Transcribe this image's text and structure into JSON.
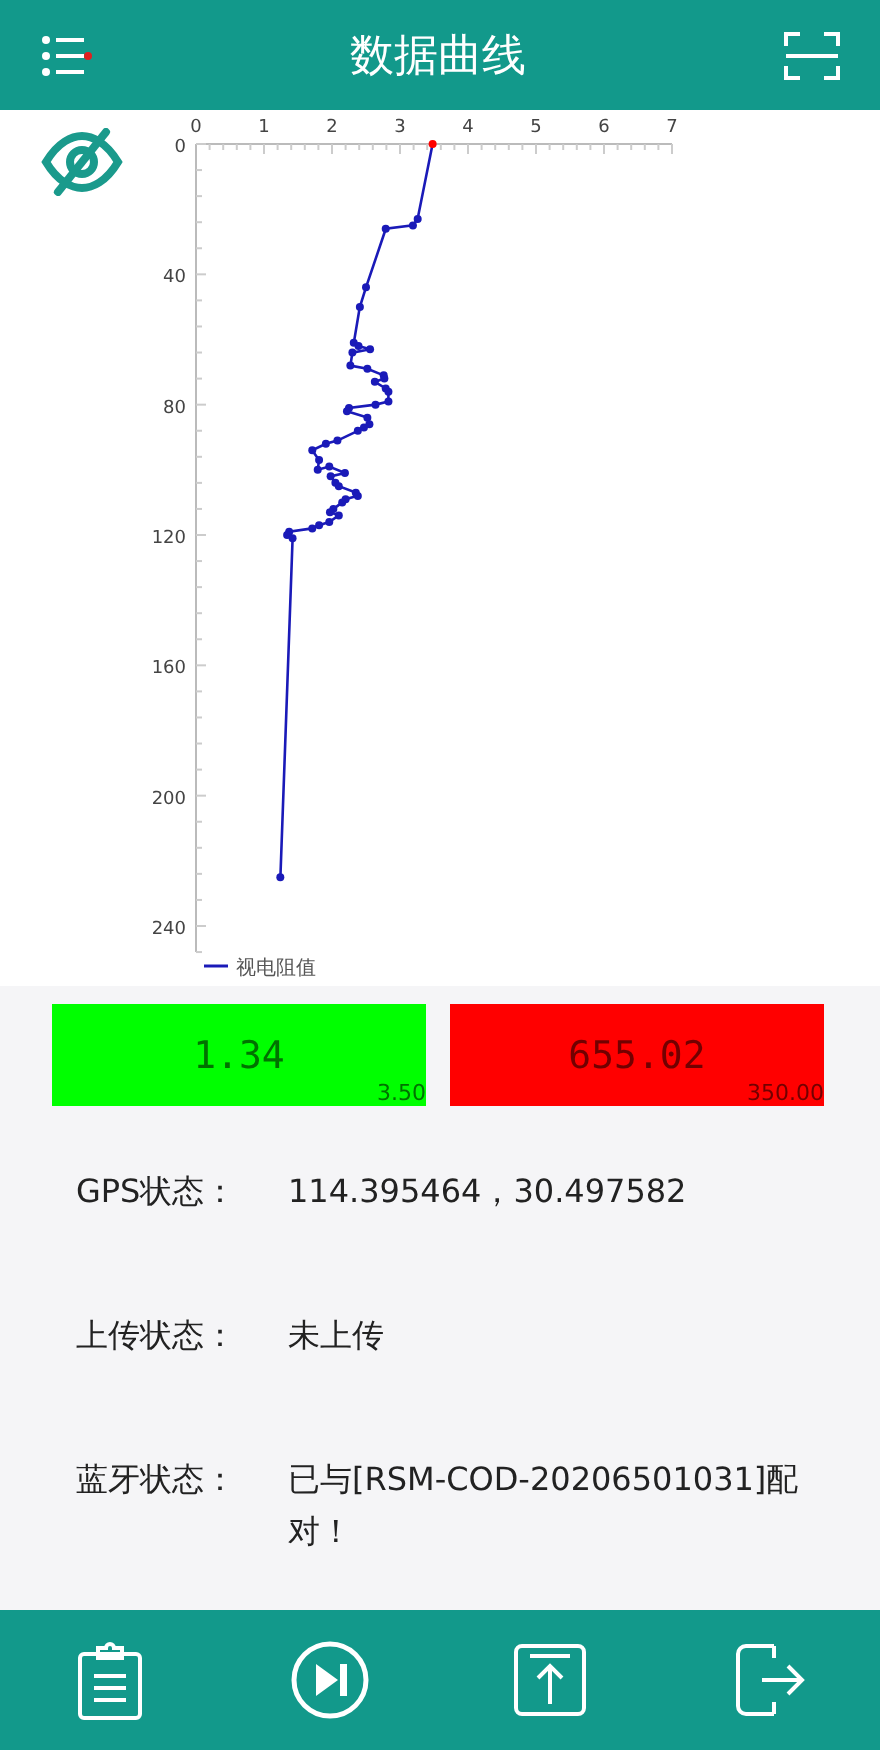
{
  "header": {
    "title": "数据曲线",
    "menu_badge": true
  },
  "chart": {
    "current_point": {
      "color": "#ff0000"
    },
    "chart_data": {
      "type": "line",
      "orientation": "horizontal",
      "x": [
        0,
        23,
        25,
        26,
        44,
        50,
        61,
        62,
        63,
        64,
        68,
        69,
        71,
        72,
        73,
        75,
        76,
        79,
        80,
        81,
        82,
        84,
        86,
        87,
        88,
        91,
        92,
        94,
        97,
        100,
        99,
        101,
        102,
        104,
        105,
        107,
        108,
        109,
        110,
        112,
        113,
        114,
        116,
        117,
        118,
        119,
        120,
        121,
        225
      ],
      "series": [
        {
          "name": "视电阻值",
          "color": "#1a1ab8",
          "marker": "circle",
          "values": [
            3.48,
            3.26,
            3.19,
            2.79,
            2.5,
            2.41,
            2.32,
            2.39,
            2.56,
            2.3,
            2.27,
            2.52,
            2.76,
            2.77,
            2.63,
            2.79,
            2.83,
            2.83,
            2.64,
            2.25,
            2.22,
            2.52,
            2.55,
            2.47,
            2.38,
            2.08,
            1.91,
            1.71,
            1.81,
            1.79,
            1.96,
            2.19,
            1.98,
            2.05,
            2.1,
            2.35,
            2.38,
            2.2,
            2.15,
            2.02,
            1.97,
            2.1,
            1.96,
            1.81,
            1.71,
            1.37,
            1.34,
            1.42,
            1.24
          ]
        }
      ],
      "xlim": [
        0,
        7
      ],
      "ylim": [
        248,
        0
      ],
      "xticks": [
        0,
        1,
        2,
        3,
        4,
        5,
        6,
        7
      ],
      "yticks": [
        0,
        40,
        80,
        120,
        160,
        200,
        240
      ]
    }
  },
  "tiles": [
    {
      "value": "1.34",
      "limit": "3.50",
      "color": "#00ff00"
    },
    {
      "value": "655.02",
      "limit": "350.00",
      "color": "#ff0000"
    }
  ],
  "status": [
    {
      "label": "GPS状态：",
      "value": "114.395464，30.497582"
    },
    {
      "label": "上传状态：",
      "value": "未上传"
    },
    {
      "label": "蓝牙状态：",
      "value": "已与[RSM-COD-20206501031]配对！"
    }
  ]
}
